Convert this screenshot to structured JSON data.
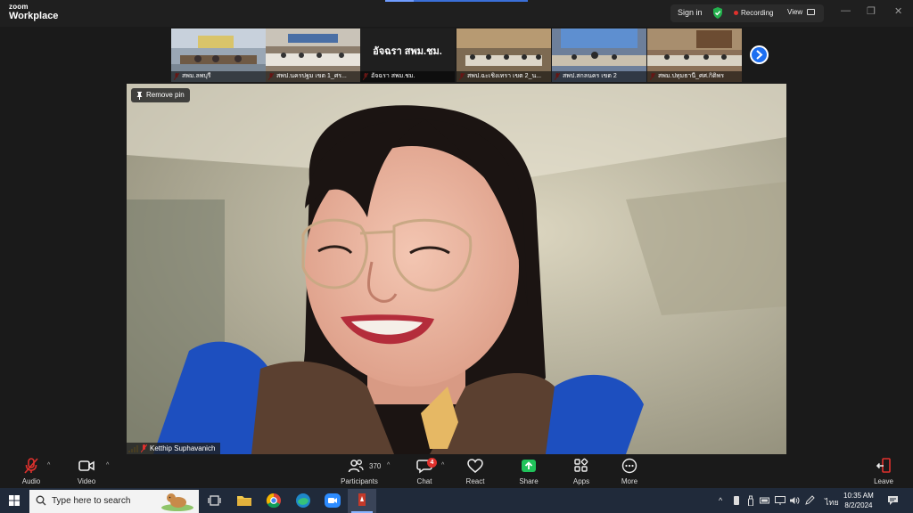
{
  "app": {
    "brand_top": "zoom",
    "brand_bottom": "Workplace"
  },
  "header": {
    "sign_in": "Sign in",
    "recording": "Recording",
    "view": "View"
  },
  "thumbnails": [
    {
      "caption": "สพม.ลพบุรี"
    },
    {
      "caption": "สพป.นครปฐม เขต 1_ศร..."
    },
    {
      "caption": "อัจฉรา สพม.ชม.",
      "big_name": "อัจฉรา สพม.ชม."
    },
    {
      "caption": "สพป.ฉะเชิงเทรา เขต 2_น..."
    },
    {
      "caption": "สพป.สกลนคร เขต 2"
    },
    {
      "caption": "สพม.ปทุมธานี_ศศ.กิติพร"
    }
  ],
  "main_video": {
    "remove_pin": "Remove pin",
    "participant_name": "Ketthip Suphavanich"
  },
  "toolbar": {
    "audio": "Audio",
    "video": "Video",
    "participants": "Participants",
    "participant_count": "370",
    "chat": "Chat",
    "chat_badge": "4",
    "react": "React",
    "share": "Share",
    "apps": "Apps",
    "more": "More",
    "leave": "Leave"
  },
  "taskbar": {
    "search_placeholder": "Type here to search",
    "language": "ไทย",
    "time": "10:35 AM",
    "date": "8/2/2024"
  },
  "colors": {
    "accent_blue": "#1d6ef0",
    "record_red": "#e0312d",
    "share_green": "#20c35a",
    "shield_green": "#23b14d"
  }
}
